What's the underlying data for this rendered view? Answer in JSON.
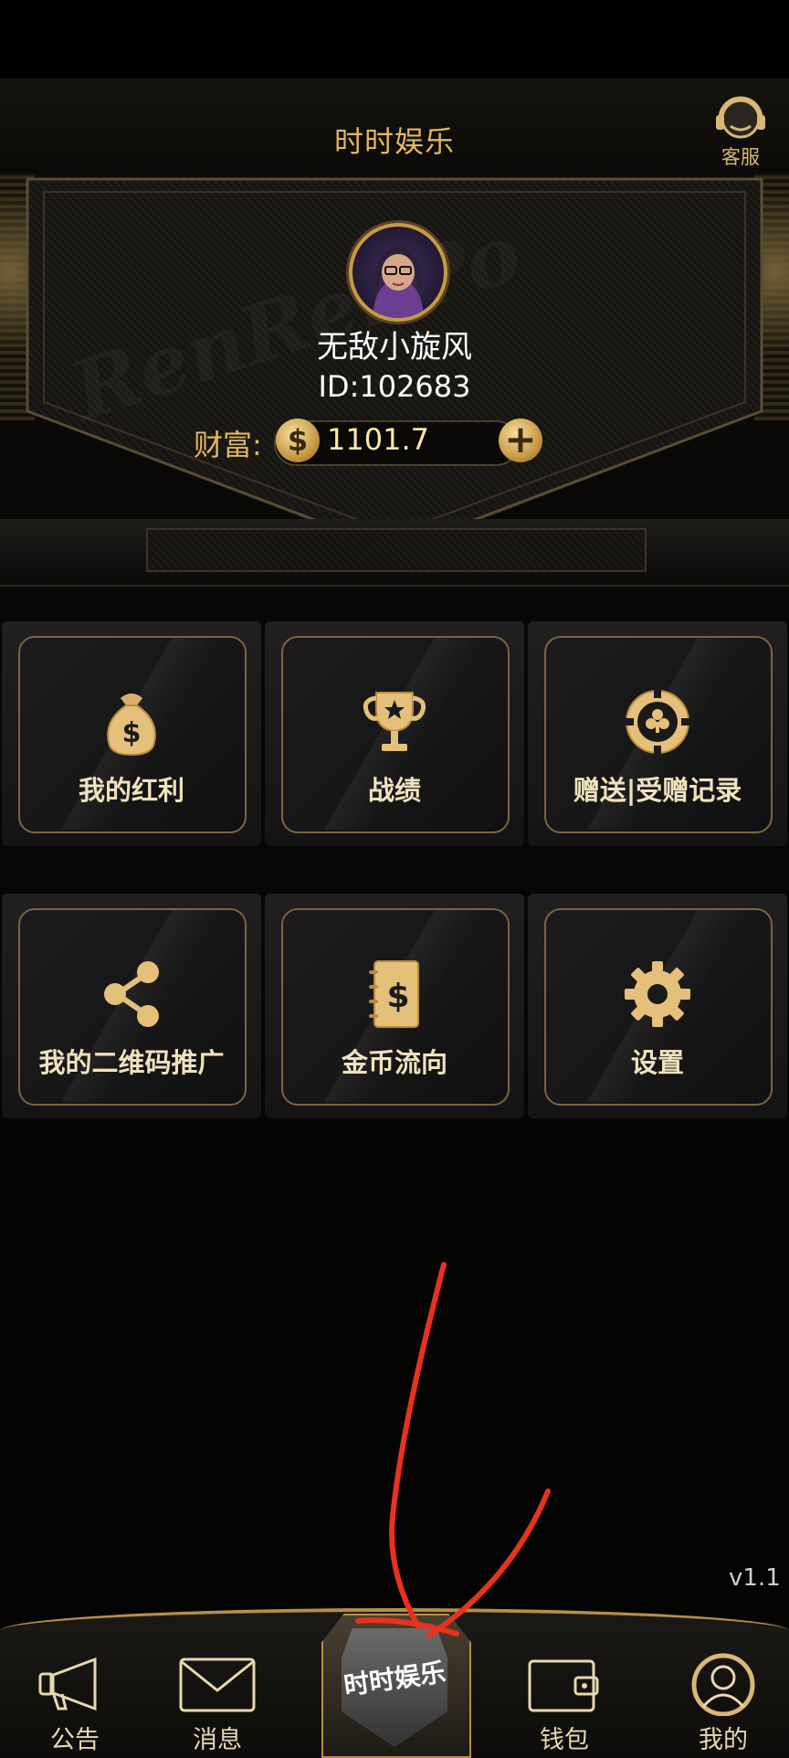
{
  "header": {
    "title": "时时娱乐",
    "support_label": "客服"
  },
  "profile": {
    "watermark": "RenRenPo",
    "username": "无敌小旋风",
    "id_text": "ID:102683",
    "wealth_label": "财富:",
    "coin_symbol": "$",
    "coin_value": "1101.7",
    "add_symbol": "+"
  },
  "menu": [
    {
      "label": "我的红利",
      "icon": "money-bag-icon"
    },
    {
      "label": "战绩",
      "icon": "trophy-icon"
    },
    {
      "label": "赠送|受赠记录",
      "icon": "poker-chip-icon"
    },
    {
      "label": "我的二维码推广",
      "icon": "share-icon"
    },
    {
      "label": "金币流向",
      "icon": "ledger-icon"
    },
    {
      "label": "设置",
      "icon": "gear-icon"
    }
  ],
  "version": "v1.1",
  "nav": {
    "items": [
      {
        "label": "公告",
        "icon": "megaphone-icon"
      },
      {
        "label": "消息",
        "icon": "envelope-icon"
      },
      {
        "label": "钱包",
        "icon": "wallet-icon"
      },
      {
        "label": "我的",
        "icon": "user-icon"
      }
    ],
    "center_label": "时时娱乐"
  },
  "colors": {
    "gold": "#e2b762",
    "background": "#000000",
    "annotation": "#e8321e"
  }
}
